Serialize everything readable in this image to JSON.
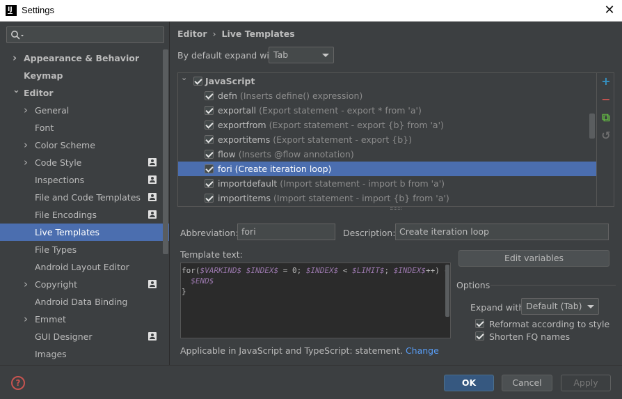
{
  "window": {
    "title": "Settings",
    "app_icon": "intellij-icon"
  },
  "sidebar": {
    "search_placeholder": "",
    "items": [
      {
        "label": "Appearance & Behavior",
        "level": 0,
        "expandable": true,
        "expanded": false,
        "bold": true,
        "shared": false
      },
      {
        "label": "Keymap",
        "level": 0,
        "expandable": false,
        "bold": true,
        "shared": false
      },
      {
        "label": "Editor",
        "level": 0,
        "expandable": true,
        "expanded": true,
        "bold": true,
        "shared": false
      },
      {
        "label": "General",
        "level": 1,
        "expandable": true,
        "expanded": false,
        "shared": false
      },
      {
        "label": "Font",
        "level": 1,
        "expandable": false,
        "shared": false
      },
      {
        "label": "Color Scheme",
        "level": 1,
        "expandable": true,
        "expanded": false,
        "shared": false
      },
      {
        "label": "Code Style",
        "level": 1,
        "expandable": true,
        "expanded": false,
        "shared": true
      },
      {
        "label": "Inspections",
        "level": 1,
        "expandable": false,
        "shared": true
      },
      {
        "label": "File and Code Templates",
        "level": 1,
        "expandable": false,
        "shared": true
      },
      {
        "label": "File Encodings",
        "level": 1,
        "expandable": false,
        "shared": true
      },
      {
        "label": "Live Templates",
        "level": 1,
        "expandable": false,
        "shared": false,
        "selected": true
      },
      {
        "label": "File Types",
        "level": 1,
        "expandable": false,
        "shared": false
      },
      {
        "label": "Android Layout Editor",
        "level": 1,
        "expandable": false,
        "shared": false
      },
      {
        "label": "Copyright",
        "level": 1,
        "expandable": true,
        "expanded": false,
        "shared": true
      },
      {
        "label": "Android Data Binding",
        "level": 1,
        "expandable": false,
        "shared": false
      },
      {
        "label": "Emmet",
        "level": 1,
        "expandable": true,
        "expanded": false,
        "shared": false
      },
      {
        "label": "GUI Designer",
        "level": 1,
        "expandable": false,
        "shared": true
      },
      {
        "label": "Images",
        "level": 1,
        "expandable": false,
        "shared": false
      }
    ]
  },
  "breadcrumb": {
    "parent": "Editor",
    "separator": "›",
    "current": "Live Templates"
  },
  "expand_default": {
    "label": "By default expand with",
    "value": "Tab"
  },
  "templates": {
    "group": {
      "name": "JavaScript",
      "checked": true,
      "expanded": true
    },
    "items": [
      {
        "abbr": "defn",
        "desc": "(Inserts define() expression)",
        "checked": true
      },
      {
        "abbr": "exportall",
        "desc": "(Export statement - export * from 'a')",
        "checked": true
      },
      {
        "abbr": "exportfrom",
        "desc": "(Export statement - export {b} from 'a')",
        "checked": true
      },
      {
        "abbr": "exportitems",
        "desc": "(Export statement - export {b})",
        "checked": true
      },
      {
        "abbr": "flow",
        "desc": "(Inserts @flow annotation)",
        "checked": true
      },
      {
        "abbr": "fori",
        "desc": "(Create iteration loop)",
        "checked": true,
        "selected": true
      },
      {
        "abbr": "importdefault",
        "desc": "(Import statement - import b from 'a')",
        "checked": true
      },
      {
        "abbr": "importitems",
        "desc": "(Import statement - import {b} from 'a')",
        "checked": true
      }
    ],
    "tools": [
      {
        "name": "add-icon",
        "glyph": "+",
        "color": "#3592c4"
      },
      {
        "name": "remove-icon",
        "glyph": "−",
        "color": "#c75450"
      },
      {
        "name": "copy-icon",
        "glyph": "⧉",
        "color": "#62b543"
      },
      {
        "name": "restore-icon",
        "glyph": "↺",
        "color": "#6e6e6e"
      }
    ]
  },
  "details": {
    "abbreviation_label": "Abbreviation:",
    "abbreviation_value": "fori",
    "description_label": "Description:",
    "description_value": "Create iteration loop",
    "template_text_label": "Template text:",
    "template_lines": [
      "for($VARKIND$ $INDEX$ = 0; $INDEX$ < $LIMIT$; $INDEX$++) {",
      "  $END$",
      "}"
    ],
    "edit_variables_label": "Edit variables",
    "options_label": "Options",
    "expand_with_label": "Expand with",
    "expand_with_value": "Default (Tab)",
    "reformat_label": "Reformat according to style",
    "reformat_checked": true,
    "shorten_label": "Shorten FQ names",
    "shorten_checked": true,
    "applicable_text": "Applicable in JavaScript and TypeScript: statement.",
    "change_link": "Change"
  },
  "footer": {
    "ok": "OK",
    "cancel": "Cancel",
    "apply": "Apply"
  },
  "colors": {
    "selection": "#4b6eaf",
    "primary_button": "#365880",
    "link": "#589df6",
    "help": "#c75450"
  }
}
